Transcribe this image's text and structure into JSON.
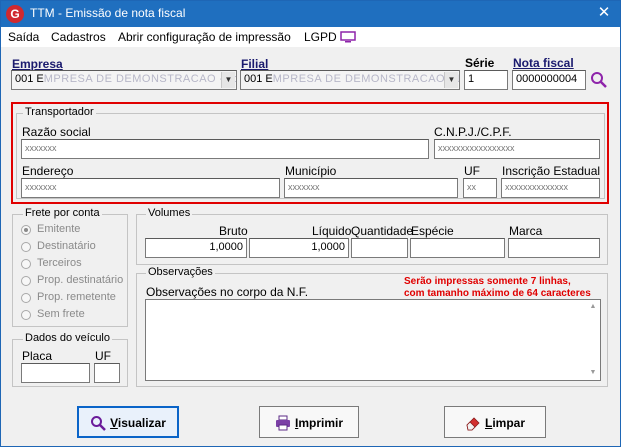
{
  "window": {
    "title": "TTM - Emissão de nota fiscal",
    "app_icon_letter": "G"
  },
  "menu": {
    "items": [
      "Saída",
      "Cadastros",
      "Abrir configuração de impressão",
      "LGPD"
    ]
  },
  "header": {
    "empresa_label": "Empresa",
    "empresa_value": "001 E",
    "empresa_blurred": "MPRESA DE DEMONSTRACAO - Todo",
    "filial_label": "Filial",
    "filial_value": "001 E",
    "filial_blurred": "MPRESA DE DEMONSTRACAO - LAB",
    "serie_label": "Série",
    "serie_value": "1",
    "nota_label": "Nota fiscal",
    "nota_value": "0000000004"
  },
  "transportador": {
    "title": "Transportador",
    "razao_label": "Razão social",
    "razao_value": "xxxxxxx",
    "cnpj_label": "C.N.P.J./C.P.F.",
    "cnpj_value": "xxxxxxxxxxxxxxxxx",
    "endereco_label": "Endereço",
    "endereco_value": "xxxxxxx",
    "municipio_label": "Município",
    "municipio_value": "xxxxxxx",
    "uf_label": "UF",
    "uf_value": "xx",
    "ie_label": "Inscrição Estadual",
    "ie_value": "xxxxxxxxxxxxxx"
  },
  "frete": {
    "title": "Frete por conta",
    "options": [
      "Emitente",
      "Destinatário",
      "Terceiros",
      "Prop. destinatário",
      "Prop. remetente",
      "Sem frete"
    ],
    "selected": "Emitente"
  },
  "volumes": {
    "title": "Volumes",
    "bruto_label": "Bruto",
    "bruto_value": "1,0000",
    "liquido_label": "Líquido",
    "liquido_value": "1,0000",
    "quantidade_label": "Quantidade",
    "quantidade_value": "",
    "especie_label": "Espécie",
    "especie_value": "",
    "marca_label": "Marca",
    "marca_value": ""
  },
  "veiculo": {
    "title": "Dados do veículo",
    "placa_label": "Placa",
    "placa_value": "",
    "uf_label": "UF",
    "uf_value": ""
  },
  "observacoes": {
    "title": "Observações",
    "corpo_label": "Observações no corpo da N.F.",
    "note_line1": "Serão impressas somente 7 linhas,",
    "note_line2": "com tamanho máximo de 64 caracteres",
    "value": ""
  },
  "buttons": {
    "visualizar_underline": "V",
    "visualizar_rest": "isualizar",
    "imprimir_underline": "I",
    "imprimir_rest": "mprimir",
    "limpar_underline": "L",
    "limpar_rest": "impar"
  },
  "colors": {
    "title_bar": "#1f6fbf",
    "highlight_border": "#e00000",
    "note_text": "#e00000",
    "primary_button_border": "#0a64c8"
  }
}
